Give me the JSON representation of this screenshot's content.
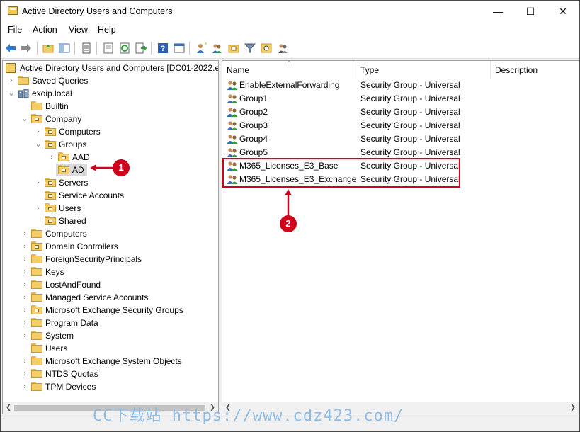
{
  "window": {
    "title": "Active Directory Users and Computers",
    "minimize": "—",
    "maximize": "☐",
    "close": "✕"
  },
  "menu": [
    "File",
    "Action",
    "View",
    "Help"
  ],
  "toolbar_icons": [
    "back-arrow-icon",
    "forward-arrow-icon",
    "up-folder-icon",
    "show-hide-tree-icon",
    "properties-icon",
    "export-list-icon",
    "refresh-icon",
    "export-icon",
    "help-icon",
    "console-tree-icon",
    "new-user-icon",
    "new-group-icon",
    "new-ou-icon",
    "filter-icon",
    "find-icon",
    "add-to-group-icon"
  ],
  "tree": [
    {
      "label": "Active Directory Users and Computers [DC01-2022.ex",
      "icon": "root"
    },
    {
      "label": "Saved Queries"
    },
    {
      "label": "exoip.local"
    },
    {
      "label": "Builtin"
    },
    {
      "label": "Company"
    },
    {
      "label": "Computers"
    },
    {
      "label": "Groups"
    },
    {
      "label": "AAD"
    },
    {
      "label": "AD"
    },
    {
      "label": "Servers"
    },
    {
      "label": "Service Accounts"
    },
    {
      "label": "Users"
    },
    {
      "label": "Shared"
    },
    {
      "label": "Computers"
    },
    {
      "label": "Domain Controllers"
    },
    {
      "label": "ForeignSecurityPrincipals"
    },
    {
      "label": "Keys"
    },
    {
      "label": "LostAndFound"
    },
    {
      "label": "Managed Service Accounts"
    },
    {
      "label": "Microsoft Exchange Security Groups"
    },
    {
      "label": "Program Data"
    },
    {
      "label": "System"
    },
    {
      "label": "Users"
    },
    {
      "label": "Microsoft Exchange System Objects"
    },
    {
      "label": "NTDS Quotas"
    },
    {
      "label": "TPM Devices"
    }
  ],
  "columns": {
    "name": "Name",
    "type": "Type",
    "description": "Description"
  },
  "rows": [
    {
      "name": "EnableExternalForwarding",
      "type": "Security Group - Universal"
    },
    {
      "name": "Group1",
      "type": "Security Group - Universal"
    },
    {
      "name": "Group2",
      "type": "Security Group - Universal"
    },
    {
      "name": "Group3",
      "type": "Security Group - Universal"
    },
    {
      "name": "Group4",
      "type": "Security Group - Universal"
    },
    {
      "name": "Group5",
      "type": "Security Group - Universal"
    },
    {
      "name": "M365_Licenses_E3_Base",
      "type": "Security Group - Universal"
    },
    {
      "name": "M365_Licenses_E3_Exchange",
      "type": "Security Group - Universal"
    }
  ],
  "annotations": {
    "badge1": "1",
    "badge2": "2",
    "color": "#d0021b"
  },
  "watermark": "CC下载站 https://www.cdz423.com/"
}
